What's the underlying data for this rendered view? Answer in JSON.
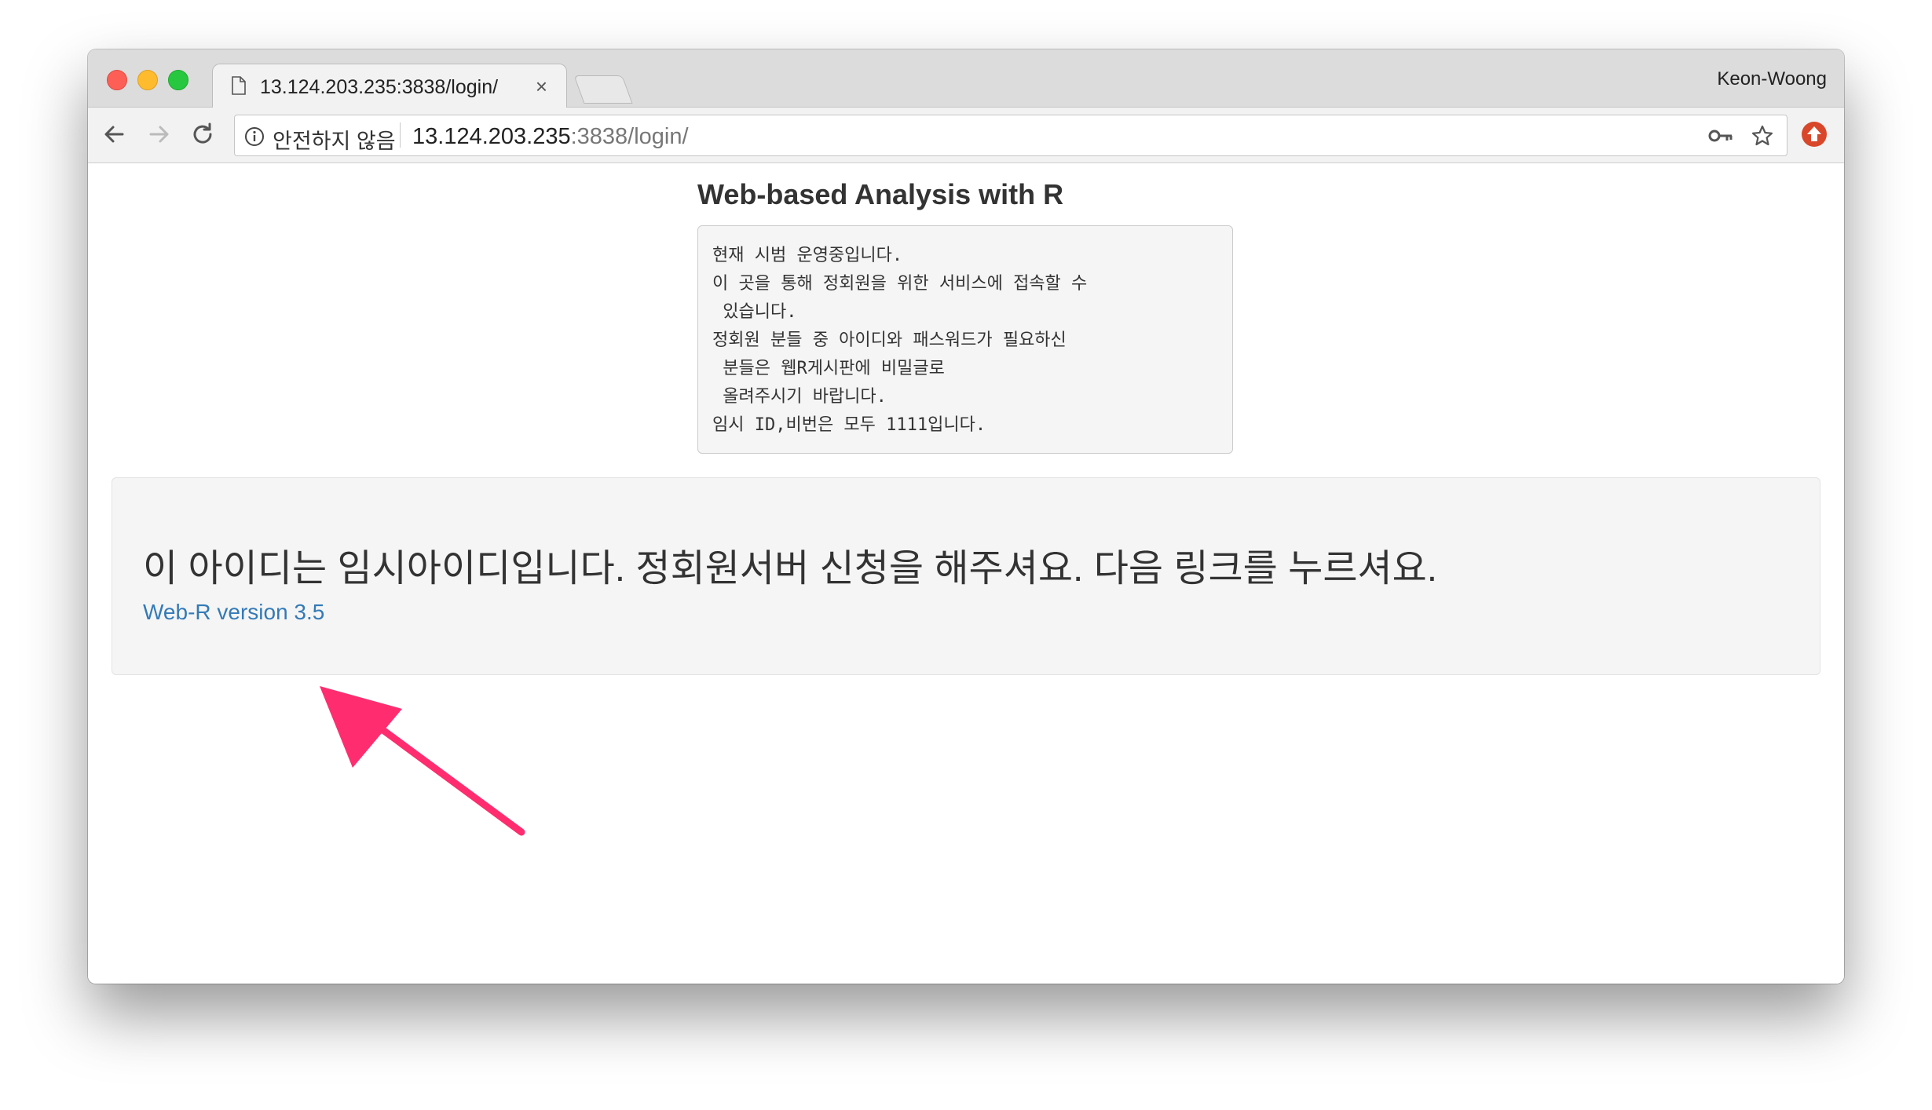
{
  "browser": {
    "tab_title": "13.124.203.235:3838/login/",
    "tab_close": "×",
    "profile_name": "Keon-Woong",
    "security_label": "안전하지 않음",
    "url_host": "13.124.203.235",
    "url_rest": ":3838/login/",
    "icons": [
      "back-icon",
      "forward-icon",
      "reload-icon",
      "info-icon",
      "key-icon",
      "star-icon",
      "extension-icon"
    ]
  },
  "page": {
    "title": "Web-based Analysis with R",
    "notice_lines": [
      "현재 시범 운영중입니다.",
      "이 곳을 통해 정회원을 위한 서비스에 접속할 수",
      " 있습니다.",
      "정회원 분들 중 아이디와 패스워드가 필요하신",
      " 분들은 웹R게시판에 비밀글로",
      " 올려주시기 바랍니다.",
      "임시 ID,비번은 모두 1111입니다."
    ],
    "message": "이 아이디는 임시아이디입니다. 정회원서버 신청을 해주셔요. 다음 링크를 누르셔요.",
    "link_text": "Web-R version 3.5"
  },
  "colors": {
    "link": "#337ab7",
    "annotation_arrow": "#ff2d6f",
    "well_bg": "#f5f5f5"
  }
}
